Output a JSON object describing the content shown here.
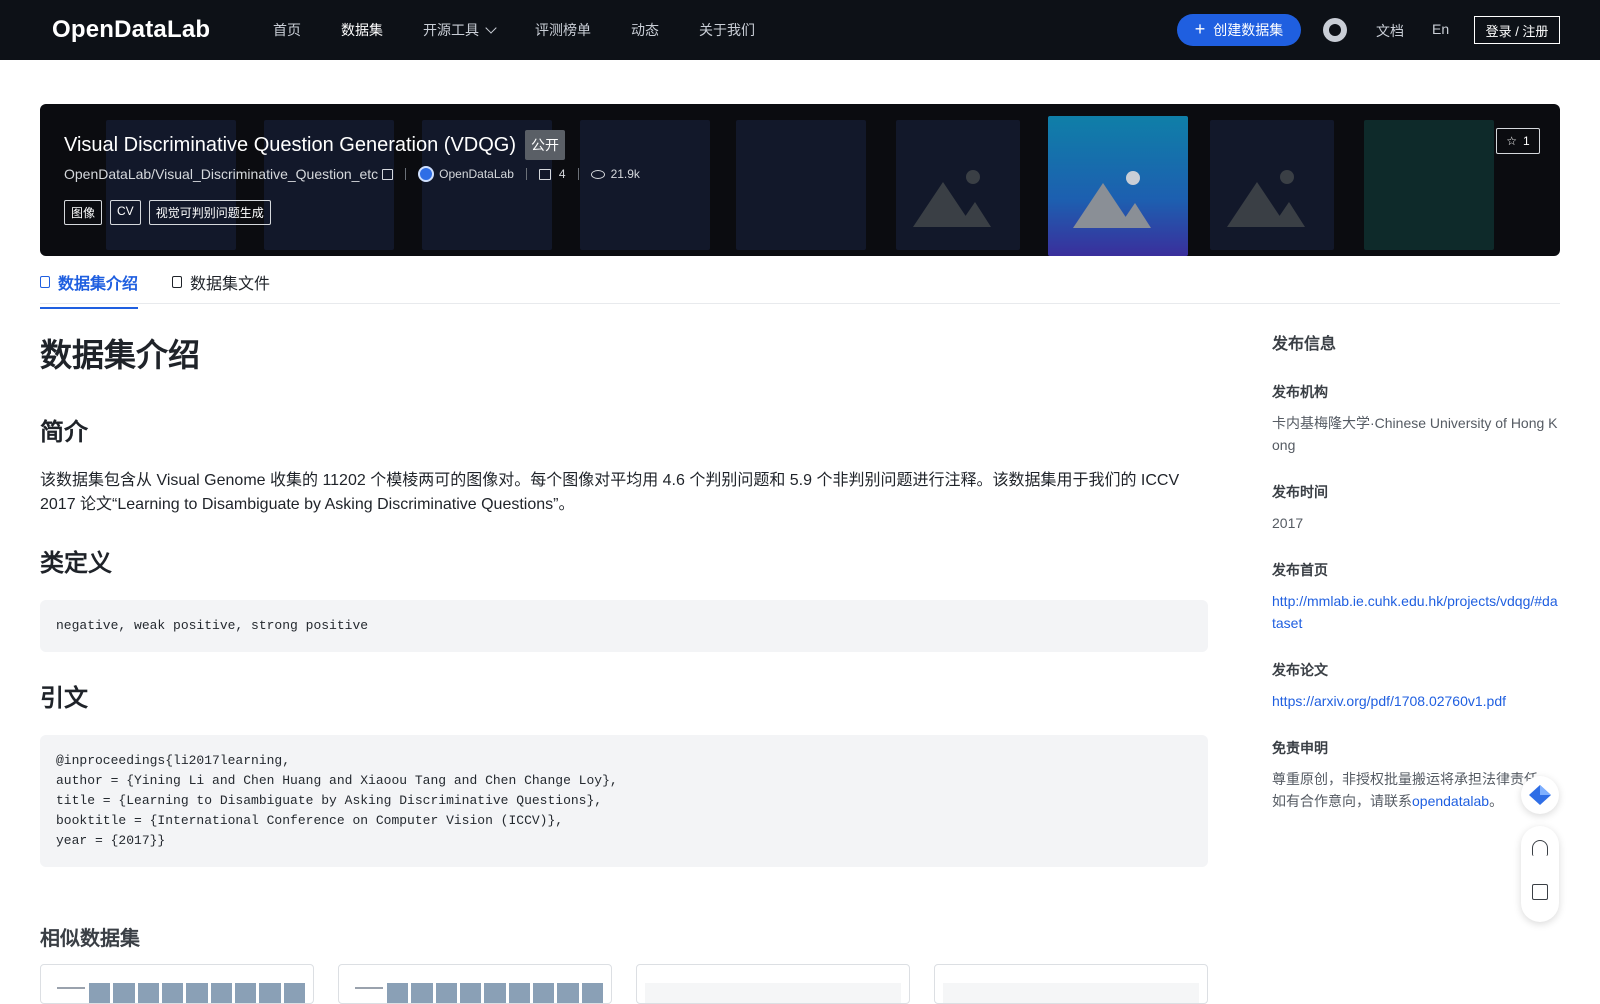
{
  "nav": {
    "logo": "OpenDataLab",
    "items": [
      "首页",
      "数据集",
      "开源工具",
      "评测榜单",
      "动态",
      "关于我们"
    ],
    "create_label": "创建数据集",
    "docs": "文档",
    "lang": "En",
    "login": "登录 / 注册"
  },
  "banner": {
    "title": "Visual Discriminative Question Generation (VDQG)",
    "badge": "公开",
    "repo": "OpenDataLab/Visual_Discriminative_Question_etc",
    "org": "OpenDataLab",
    "files": "4",
    "views": "21.9k",
    "tags": [
      "图像",
      "CV",
      "视觉可判别问题生成"
    ],
    "stars": "1"
  },
  "tabs": [
    "数据集介绍",
    "数据集文件"
  ],
  "content": {
    "title": "数据集介绍",
    "intro_heading": "简介",
    "intro": "该数据集包含从 Visual Genome 收集的 11202 个模棱两可的图像对。每个图像对平均用 4.6 个判别问题和 5.9 个非判别问题进行注释。该数据集用于我们的 ICCV 2017 论文“Learning to Disambiguate by Asking Discriminative Questions”。",
    "classes_heading": "类定义",
    "classes": "negative, weak positive, strong positive",
    "cite_heading": "引文",
    "citation": "@inproceedings{li2017learning,\nauthor = {Yining Li and Chen Huang and Xiaoou Tang and Chen Change Loy},\ntitle = {Learning to Disambiguate by Asking Discriminative Questions},\nbooktitle = {International Conference on Computer Vision (ICCV)},\nyear = {2017}}",
    "similar": "相似数据集"
  },
  "side": {
    "title": "发布信息",
    "org_label": "发布机构",
    "org": "卡内基梅隆大学·Chinese University of Hong Kong",
    "date_label": "发布时间",
    "date": "2017",
    "home_label": "发布首页",
    "home": "http://mmlab.ie.cuhk.edu.hk/projects/vdqg/#dataset",
    "paper_label": "发布论文",
    "paper": "https://arxiv.org/pdf/1708.02760v1.pdf",
    "disclaimer_label": "免责申明",
    "disclaimer": "尊重原创，非授权批量搬运将承担法律责任。如有合作意向，请联系",
    "contact": "opendatalab",
    "period": "。"
  }
}
